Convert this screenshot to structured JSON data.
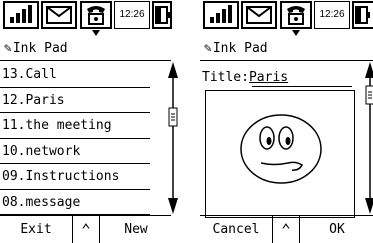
{
  "status_bar": {
    "time": "12:26"
  },
  "left": {
    "app_title": "Ink Pad",
    "notes": [
      "13.Call",
      "12.Paris",
      "11.the meeting",
      "10.network",
      "09.Instructions",
      "08.message"
    ],
    "softkeys": {
      "left": "Exit",
      "right": "New"
    }
  },
  "right": {
    "app_title": "Ink Pad",
    "title_label": "Title:",
    "title_value": "Paris",
    "softkeys": {
      "left": "Cancel",
      "right": "OK"
    }
  },
  "icons": [
    "signal-icon",
    "mail-icon",
    "phone-icon",
    "battery-icon",
    "pen-icon",
    "scroll-up-arrow-icon",
    "scroll-down-arrow-icon",
    "double-chevron-up-icon"
  ]
}
